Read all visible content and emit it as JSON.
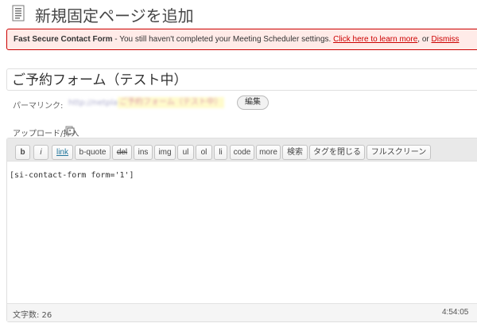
{
  "header": {
    "title": "新規固定ページを追加",
    "icon": "page-icon"
  },
  "notice": {
    "plugin_name": "Fast Secure Contact Form",
    "message": " - You still haven't completed your Meeting Scheduler settings. ",
    "learn_more_link": "Click here to learn more",
    "separator": ", or ",
    "dismiss_link": "Dismiss",
    "bg_color": "#ffebe8",
    "border_color": "#cc0000"
  },
  "title_field": {
    "value": "ご予約フォーム（テスト中）"
  },
  "permalink": {
    "label": "パーマリンク:",
    "url": "http://netplan.jp/",
    "slug": "ご予約フォーム（テスト中）",
    "edit_button": "編集"
  },
  "upload": {
    "label": "アップロード/挿入",
    "icon": "media-upload-icon"
  },
  "toolbar": {
    "buttons": [
      "b",
      "i",
      "link",
      "b-quote",
      "del",
      "ins",
      "img",
      "ul",
      "ol",
      "li",
      "code",
      "more",
      "検索",
      "タグを閉じる",
      "フルスクリーン"
    ]
  },
  "editor": {
    "content": "[si-contact-form form='1']"
  },
  "status": {
    "word_count_label": "文字数: 26",
    "last_saved": "4:54:05"
  }
}
